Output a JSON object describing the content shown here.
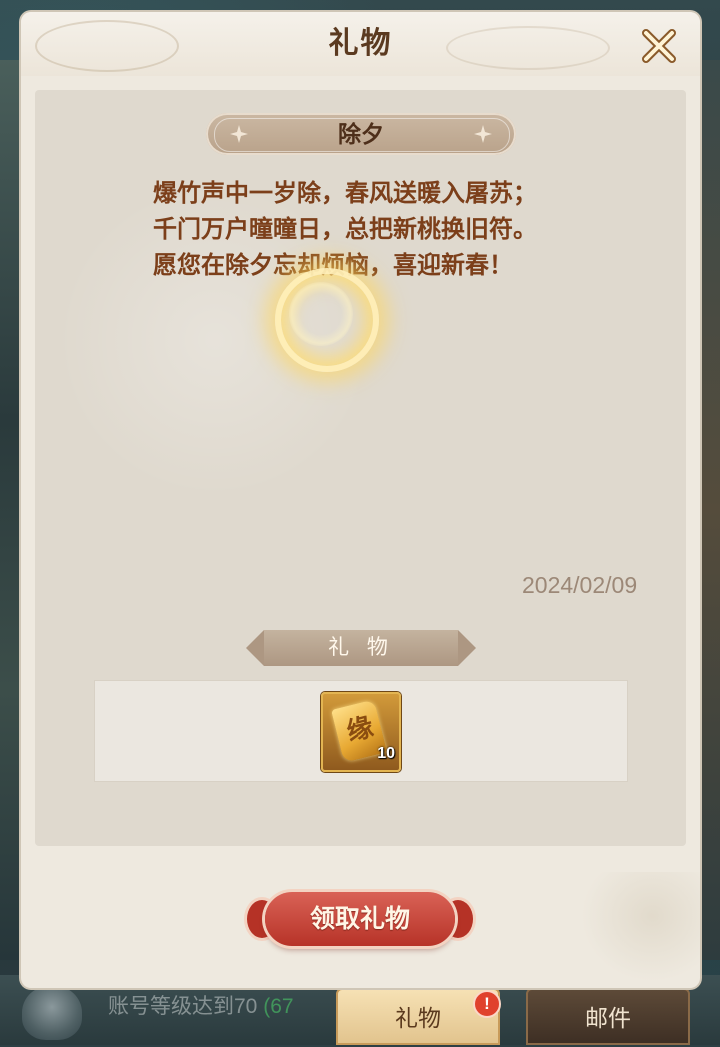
{
  "dialog": {
    "title": "礼物",
    "close_icon": "close-icon"
  },
  "message": {
    "heading": "除夕",
    "lines": [
      "爆竹声中一岁除，春风送暖入屠苏；",
      "千门万户曈曈日，总把新桃换旧符。",
      "愿您在除夕忘却烦恼，喜迎新春！"
    ],
    "date": "2024/02/09"
  },
  "gift_section": {
    "label": "礼 物",
    "items": [
      {
        "icon": "fate-scroll-icon",
        "glyph": "缘",
        "count": "10"
      }
    ]
  },
  "claim_button": {
    "label": "领取礼物"
  },
  "bottom_bar": {
    "quest_text": "账号等级达到70",
    "quest_progress": "(67",
    "tabs": [
      {
        "label": "礼物",
        "active": true,
        "badge": "!"
      },
      {
        "label": "邮件",
        "active": false
      }
    ]
  },
  "colors": {
    "accent_red": "#c0392b",
    "title_brown": "#5b3a20",
    "poem_brown": "#7c3f1a"
  }
}
